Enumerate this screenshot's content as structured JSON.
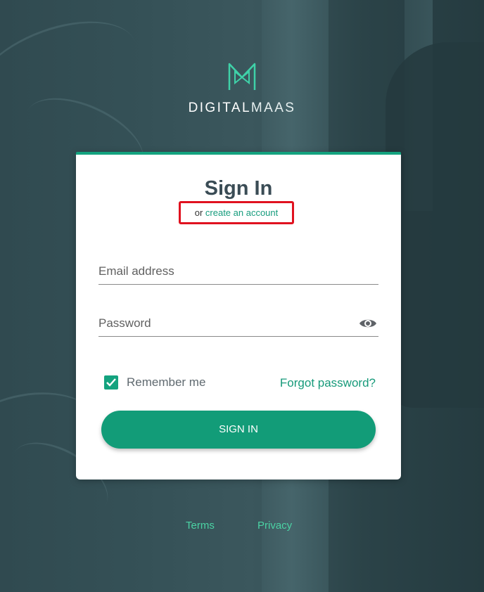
{
  "brand": {
    "name_bold": "DIGITAL",
    "name_light": "MAAS"
  },
  "card": {
    "title": "Sign In",
    "create_prefix": "or",
    "create_link": "create an account",
    "email_placeholder": "Email address",
    "password_placeholder": "Password",
    "remember_label": "Remember me",
    "remember_checked": true,
    "forgot_link": "Forgot password?",
    "signin_button": "SIGN IN"
  },
  "footer": {
    "terms": "Terms",
    "privacy": "Privacy"
  },
  "colors": {
    "accent": "#129c78",
    "highlight_box": "#e0121f",
    "background": "#2f474d"
  },
  "icons": {
    "password_toggle": "eye-icon",
    "checkbox": "checkmark-icon",
    "logo": "logo-mark-icon"
  }
}
